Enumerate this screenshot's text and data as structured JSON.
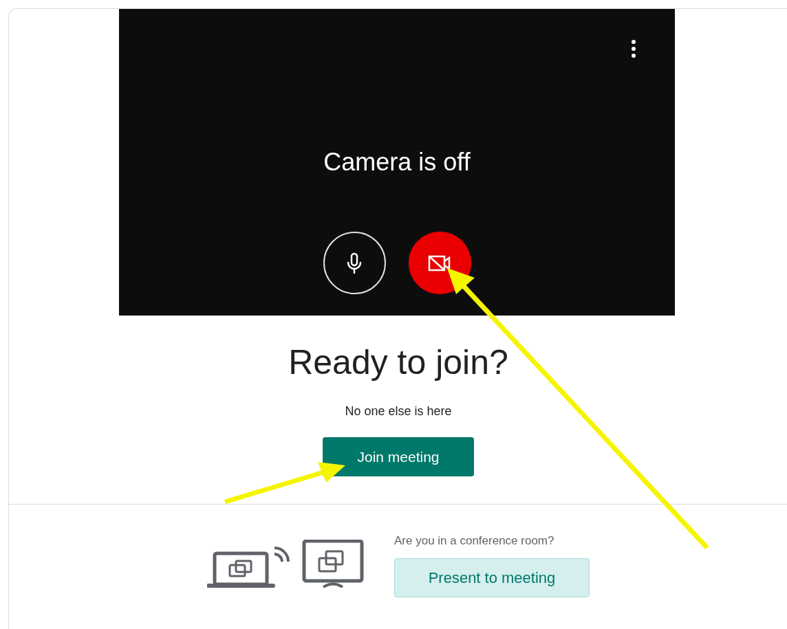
{
  "preview": {
    "status": "Camera is off",
    "controls": [
      {
        "kind": "microphone",
        "on": true
      },
      {
        "kind": "camera",
        "on": false
      }
    ]
  },
  "heading": "Ready to join?",
  "participants_note": "No one else is here",
  "join_button": "Join meeting",
  "conference_room": {
    "question": "Are you in a conference room?",
    "button": "Present to meeting"
  }
}
